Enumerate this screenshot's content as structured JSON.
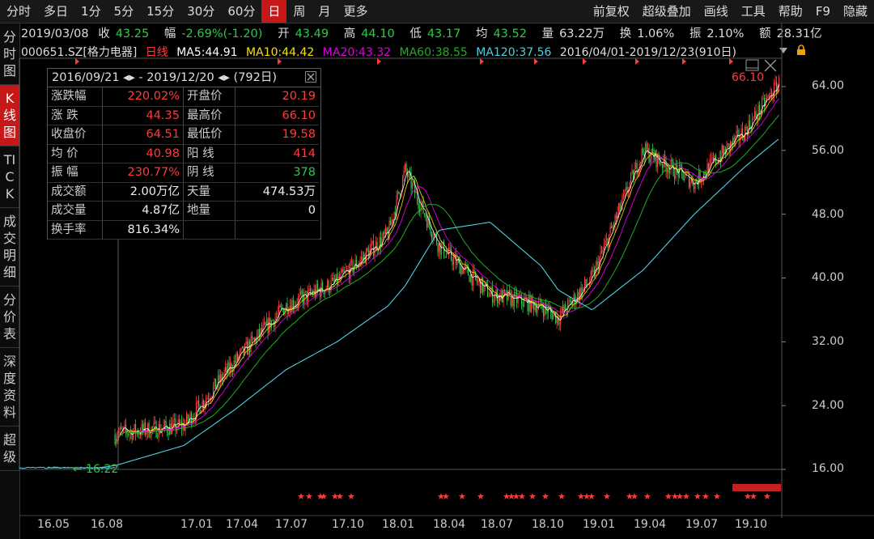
{
  "toolbar": {
    "tabs": [
      "分时",
      "多日",
      "1分",
      "5分",
      "15分",
      "30分",
      "60分",
      "日",
      "周",
      "月",
      "更多"
    ],
    "active_tab": "日",
    "right": [
      "前复权",
      "超级叠加",
      "画线",
      "工具",
      "帮助",
      "F9",
      "隐藏"
    ]
  },
  "sidebar": {
    "items": [
      "分时图",
      "K线图",
      "TICK",
      "成交明细",
      "分价表",
      "深度资料",
      "超级"
    ],
    "active": "K线图"
  },
  "quote": {
    "date": "2019/03/08",
    "close_label": "收",
    "close": "43.25",
    "change_label": "幅",
    "change": "-2.69%(-1.20)",
    "open_label": "开",
    "open": "43.49",
    "high_label": "高",
    "high": "44.10",
    "low_label": "低",
    "low": "43.17",
    "avg_label": "均",
    "avg": "43.52",
    "volume_label": "量",
    "volume": "63.22万",
    "turnover_label": "换",
    "turnover": "1.06%",
    "amplitude_label": "振",
    "amplitude": "2.10%",
    "amount_label": "额",
    "amount": "28.31亿"
  },
  "ma_line": {
    "code": "000651.SZ",
    "name": "[格力电器]",
    "period": "日线",
    "ma5": "MA5:44.91",
    "ma10": "MA10:44.42",
    "ma20": "MA20:43.32",
    "ma60": "MA60:38.55",
    "ma120": "MA120:37.56",
    "range": "2016/04/01-2019/12/23(910日)"
  },
  "stats": {
    "range": "2016/09/21 ◂▸ - 2019/12/20 ◂▸  (792日)",
    "rows": [
      {
        "k1": "涨跌幅",
        "v1": "220.02%",
        "c1": "red",
        "k2": "开盘价",
        "v2": "20.19",
        "c2": "red"
      },
      {
        "k1": "涨  跌",
        "v1": "44.35",
        "c1": "red",
        "k2": "最高价",
        "v2": "66.10",
        "c2": "red"
      },
      {
        "k1": "收盘价",
        "v1": "64.51",
        "c1": "red",
        "k2": "最低价",
        "v2": "19.58",
        "c2": "red"
      },
      {
        "k1": "均  价",
        "v1": "40.98",
        "c1": "red",
        "k2": "阳  线",
        "v2": "414",
        "c2": "red"
      },
      {
        "k1": "振  幅",
        "v1": "230.77%",
        "c1": "red",
        "k2": "阴  线",
        "v2": "378",
        "c2": "green"
      },
      {
        "k1": "成交额",
        "v1": "2.00万亿",
        "c1": "white",
        "k2": "天量",
        "v2": "474.53万",
        "c2": "white"
      },
      {
        "k1": "成交量",
        "v1": "4.87亿",
        "c1": "white",
        "k2": "地量",
        "v2": "0",
        "c2": "white"
      },
      {
        "k1": "换手率",
        "v1": "816.34%",
        "c1": "white",
        "k2": "",
        "v2": "",
        "c2": "white"
      }
    ]
  },
  "y_axis": [
    "64.00",
    "56.00",
    "48.00",
    "40.00",
    "32.00",
    "24.00",
    "16.00"
  ],
  "x_axis": [
    "16.05",
    "16.08",
    "17.01",
    "17.04",
    "17.07",
    "17.10",
    "18.01",
    "18.04",
    "18.07",
    "18.10",
    "19.01",
    "19.04",
    "19.07",
    "19.10"
  ],
  "annotations": {
    "high_label": "66.10",
    "low_label": "16.22"
  },
  "colors": {
    "up": "#ff3b3b",
    "down": "#2ec84a",
    "ma5": "#ffffff",
    "ma10": "#f5e000",
    "ma20": "#e000e0",
    "ma60": "#22aa22",
    "ma120": "#4fd0e0",
    "active": "#c61818"
  },
  "chart_data": {
    "type": "line",
    "title": "000651.SZ [格力电器] 日线",
    "ylim": [
      16,
      66.1
    ],
    "x": [
      "16.05",
      "16.08",
      "16.09",
      "17.01",
      "17.04",
      "17.07",
      "17.10",
      "18.01",
      "18.02",
      "18.04",
      "18.07",
      "18.10",
      "18.11",
      "19.01",
      "19.04",
      "19.07",
      "19.10",
      "19.12"
    ],
    "series": [
      {
        "name": "收盘价",
        "values": [
          16.2,
          16.4,
          20.5,
          21.5,
          29.5,
          36.5,
          39.5,
          45.5,
          53.5,
          44.0,
          38.0,
          36.5,
          35.0,
          40.0,
          56.0,
          52.0,
          58.5,
          64.5
        ]
      },
      {
        "name": "MA120",
        "values": [
          16.2,
          16.2,
          16.5,
          19.0,
          23.5,
          28.5,
          32.0,
          36.5,
          39.0,
          46.0,
          47.0,
          41.5,
          38.5,
          36.0,
          41.0,
          48.0,
          54.0,
          57.5
        ]
      }
    ]
  }
}
